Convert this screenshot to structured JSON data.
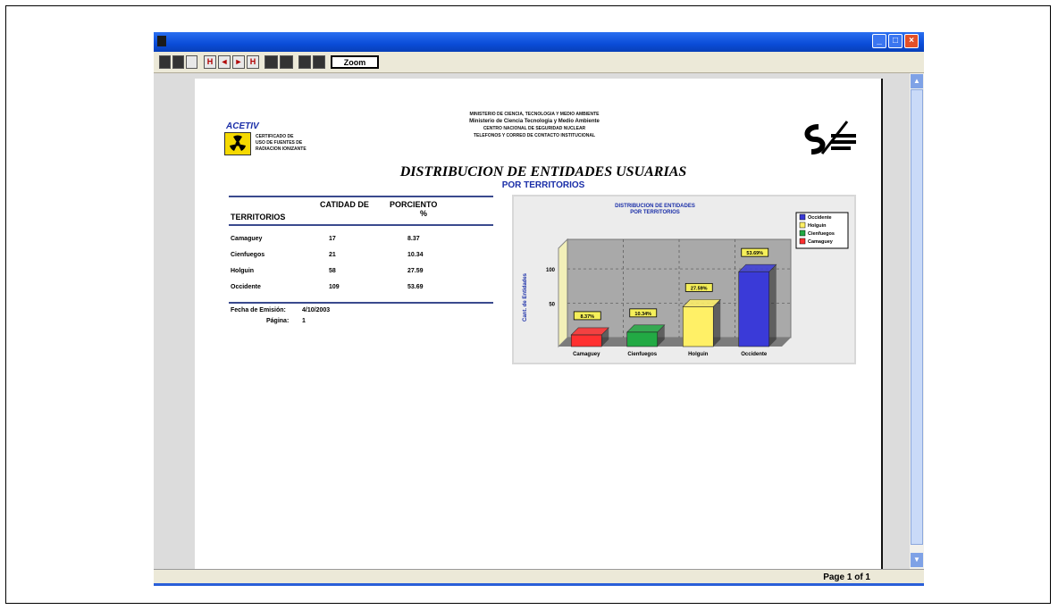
{
  "window": {
    "minimize_glyph": "_",
    "maximize_glyph": "□",
    "close_glyph": "×"
  },
  "toolbar": {
    "buttons": [
      "",
      "",
      "",
      "H",
      "◄",
      "►",
      "H",
      "",
      "",
      "",
      "",
      "",
      "Zoom"
    ]
  },
  "scrollbar": {
    "up_glyph": "▲",
    "down_glyph": "▼"
  },
  "status": {
    "page_text": "Page 1 of 1"
  },
  "report": {
    "logo_name": "ACETIV",
    "logo_lines": [
      "CERTIFICADO DE",
      "USO DE FUENTES DE",
      "RADIACION IONIZANTE"
    ],
    "header_lines": [
      "MINISTERIO DE CIENCIA, TECNOLOGIA Y MEDIO AMBIENTE",
      "Ministerio de Ciencia Tecnologia y Medio Ambiente",
      "CENTRO NACIONAL DE SEGURIDAD NUCLEAR",
      "TELEFONOS Y CORREO DE CONTACTO INSTITUCIONAL"
    ],
    "title": "DISTRIBUCION DE ENTIDADES USUARIAS",
    "subtitle": "POR TERRITORIOS",
    "table": {
      "col_territory": "TERRITORIOS",
      "col_quantity": "CATIDAD DE",
      "col_percent_line1": "PORCIENTO",
      "col_percent_line2": "%",
      "rows": [
        {
          "territorio": "Camaguey",
          "cantidad": "17",
          "porciento": "8.37"
        },
        {
          "territorio": "Cienfuegos",
          "cantidad": "21",
          "porciento": "10.34"
        },
        {
          "territorio": "Holguin",
          "cantidad": "58",
          "porciento": "27.59"
        },
        {
          "territorio": "Occidente",
          "cantidad": "109",
          "porciento": "53.69"
        }
      ]
    },
    "footer": {
      "date_label": "Fecha de Emisión:",
      "date_value": "4/10/2003",
      "page_label": "Página:",
      "page_value": "1"
    }
  },
  "chart_data": {
    "type": "bar",
    "title": "DISTRIBUCION DE ENTIDADES",
    "subtitle": "POR TERRITORIOS",
    "categories": [
      "Camaguey",
      "Cienfuegos",
      "Holguin",
      "Occidente"
    ],
    "values": [
      17,
      21,
      58,
      109
    ],
    "data_labels": [
      "8.37%",
      "10.34%",
      "27.59%",
      "53.69%"
    ],
    "ylabel": "Cant. de Entidades",
    "yticks": [
      50,
      100
    ],
    "ylim": [
      0,
      130
    ],
    "legend": [
      "Occidente",
      "Holguin",
      "Cienfuegos",
      "Camaguey"
    ],
    "legend_position": "top-right",
    "colors": [
      "#ff3030",
      "#22aa44",
      "#fff066",
      "#3a3ad8"
    ],
    "grid": true
  }
}
